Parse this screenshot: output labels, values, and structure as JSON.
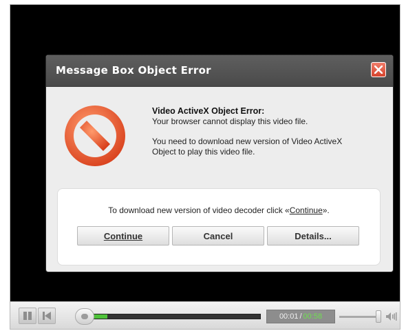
{
  "dialog": {
    "title": "Message Box Object Error",
    "heading": "Video ActiveX Object Error:",
    "line1": "Your browser cannot display this video file.",
    "para2_line1": "You need to download new version of Video ActiveX",
    "para2_line2": "Object to play this video file.",
    "download_prefix": "To download new version of video decoder click «",
    "download_link": "Continue",
    "download_suffix": "».",
    "buttons": {
      "continue": "Continue",
      "cancel": "Cancel",
      "details": "Details..."
    }
  },
  "player": {
    "time_current": "00:01",
    "time_separator": "/",
    "time_total": "00:58",
    "progress_fraction": 0.017,
    "volume_fraction": 0.92
  },
  "icons": [
    "close-icon",
    "stop-icon",
    "pause-icon",
    "previous-icon",
    "speaker-icon"
  ],
  "colors": {
    "titlebar": "#555555",
    "close_button": "#e05a43",
    "progress_green": "#4fc23a",
    "stop_icon_red": "#e8532e"
  }
}
